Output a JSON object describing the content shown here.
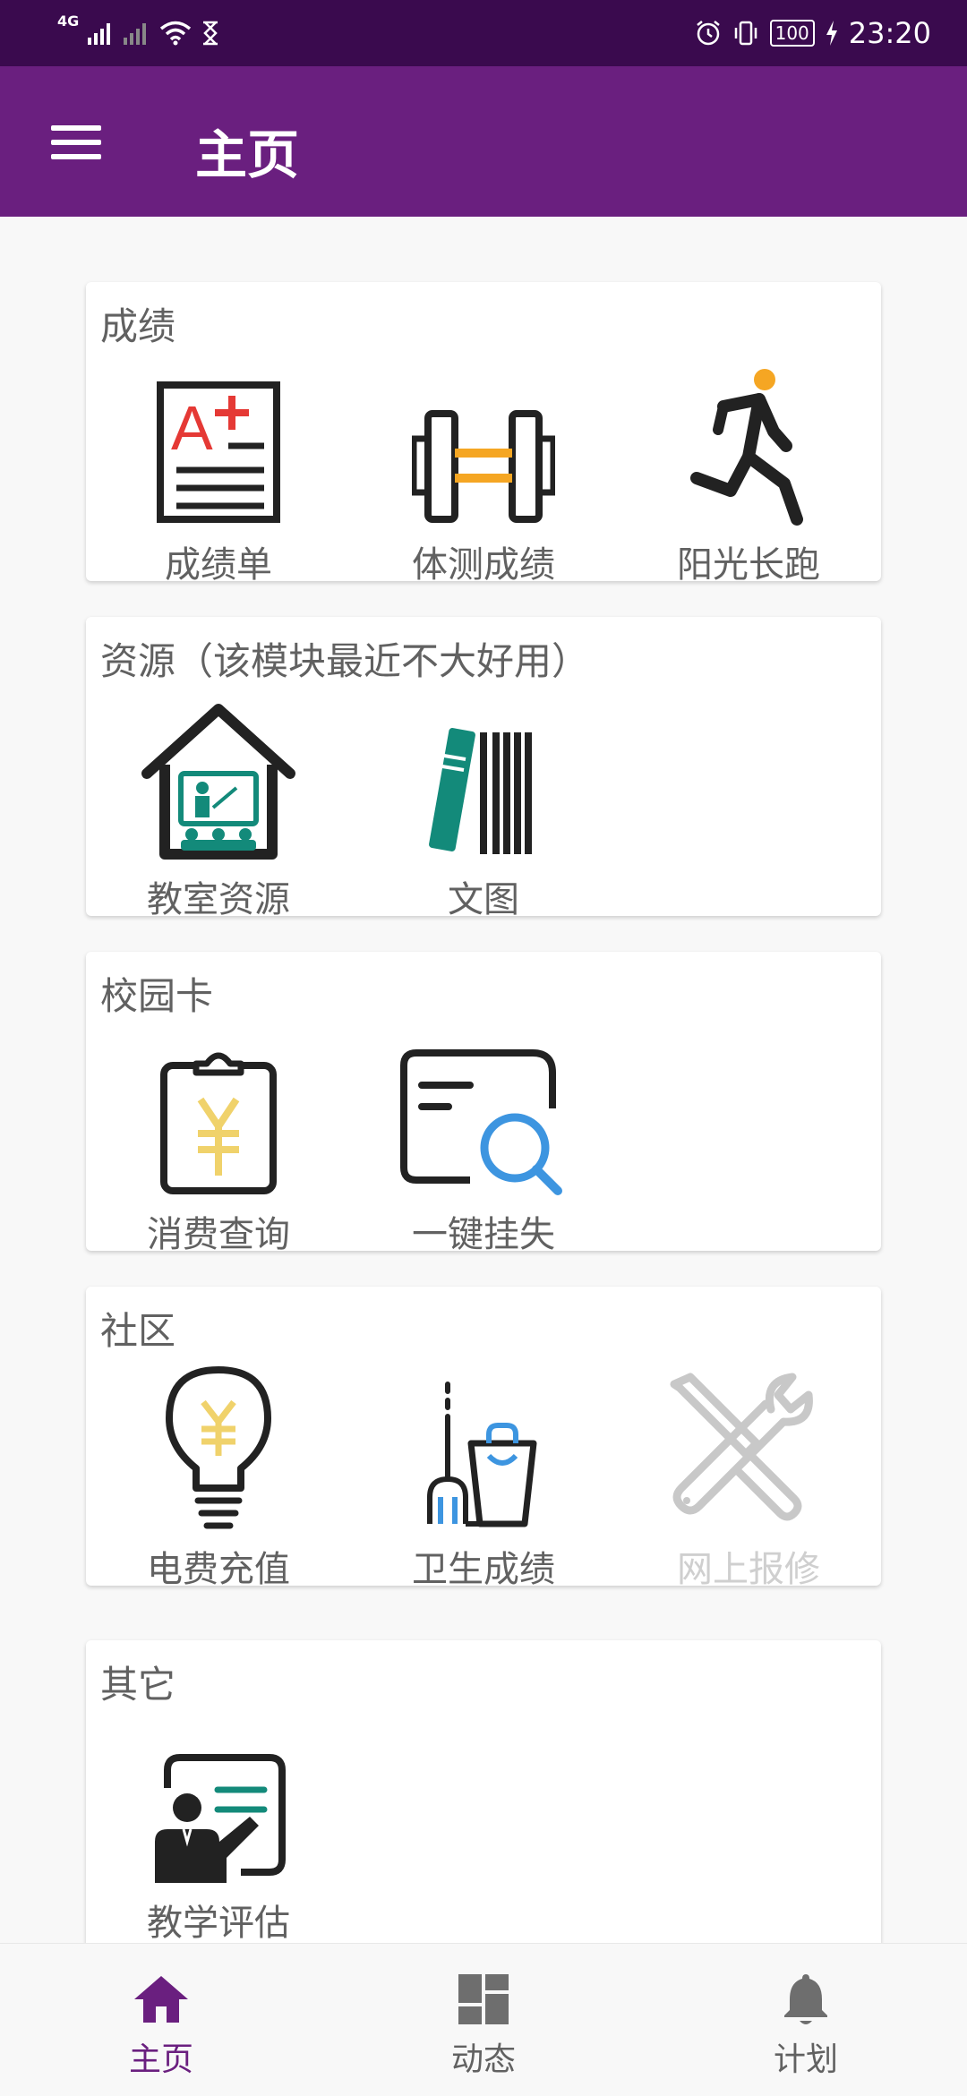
{
  "status_bar": {
    "network_label": "4G",
    "time": "23:20",
    "battery": "100"
  },
  "app_bar": {
    "title": "主页"
  },
  "sections": [
    {
      "title": "成绩",
      "items": [
        "成绩单",
        "体测成绩",
        "阳光长跑"
      ]
    },
    {
      "title": "资源（该模块最近不大好用）",
      "items": [
        "教室资源",
        "文图"
      ]
    },
    {
      "title": "校园卡",
      "items": [
        "消费查询",
        "一键挂失"
      ]
    },
    {
      "title": "社区",
      "items": [
        "电费充值",
        "卫生成绩",
        "网上报修"
      ]
    },
    {
      "title": "其它",
      "items": [
        "教学评估"
      ]
    }
  ],
  "bottom_nav": [
    {
      "label": "主页",
      "icon": "home-icon",
      "active": true
    },
    {
      "label": "动态",
      "icon": "dashboard-icon",
      "active": false
    },
    {
      "label": "计划",
      "icon": "bell-icon",
      "active": false
    }
  ],
  "colors": {
    "status_bar": "#3a0a4e",
    "app_bar": "#6a1f7f",
    "accent": "#6a1f7f",
    "teal": "#138a7a",
    "orange": "#f5a623",
    "yellow": "#f0d26b",
    "blue": "#3d95e0",
    "red": "#e53935"
  }
}
